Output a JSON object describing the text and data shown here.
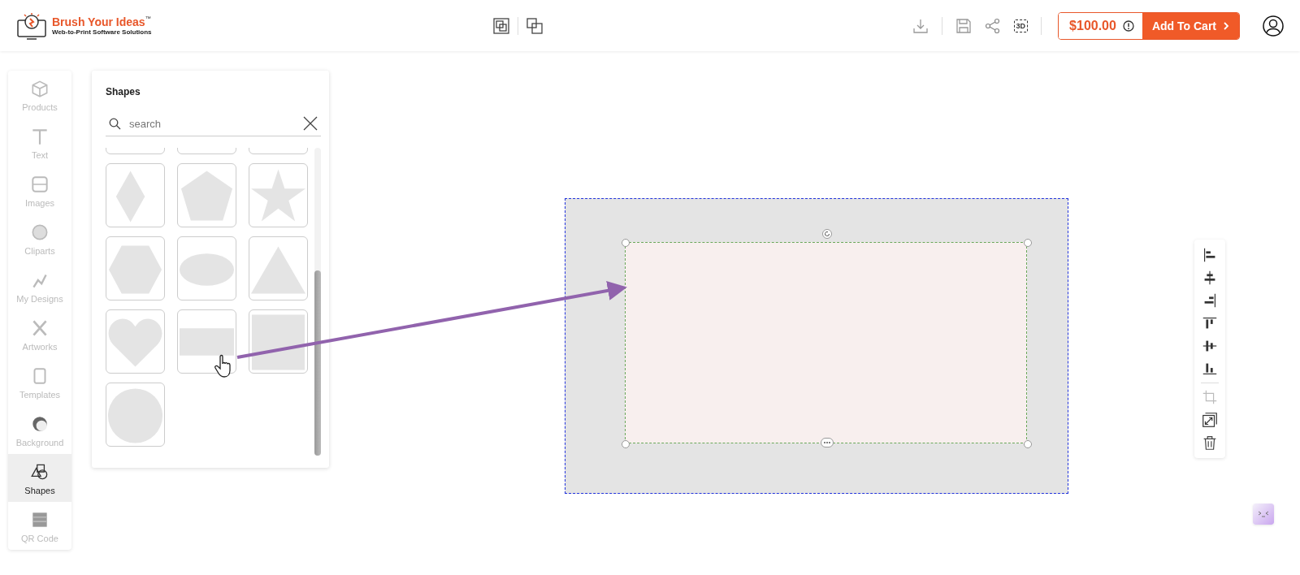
{
  "header": {
    "logo": {
      "name": "Brush Your Ideas",
      "trademark": "™",
      "tagline": "Web-to-Print Software Solutions"
    },
    "view_badge": "3D",
    "price": "$100.00",
    "cart_button": "Add To Cart"
  },
  "sidebar": {
    "items": [
      {
        "label": "Products",
        "selected": false
      },
      {
        "label": "Text",
        "selected": false
      },
      {
        "label": "Images",
        "selected": false
      },
      {
        "label": "Cliparts",
        "selected": false
      },
      {
        "label": "My Designs",
        "selected": false
      },
      {
        "label": "Artworks",
        "selected": false
      },
      {
        "label": "Templates",
        "selected": false
      },
      {
        "label": "Background",
        "selected": false
      },
      {
        "label": "Shapes",
        "selected": true
      },
      {
        "label": "QR Code",
        "selected": false
      }
    ]
  },
  "shapes_panel": {
    "title": "Shapes",
    "search": {
      "placeholder": "search"
    },
    "shapes": [
      {
        "kind": "cut"
      },
      {
        "kind": "cut"
      },
      {
        "kind": "cut"
      },
      {
        "kind": "diamond"
      },
      {
        "kind": "pentagon"
      },
      {
        "kind": "star"
      },
      {
        "kind": "hexagon"
      },
      {
        "kind": "ellipse"
      },
      {
        "kind": "triangle"
      },
      {
        "kind": "heart"
      },
      {
        "kind": "rectangle"
      },
      {
        "kind": "square"
      },
      {
        "kind": "circle"
      }
    ]
  }
}
